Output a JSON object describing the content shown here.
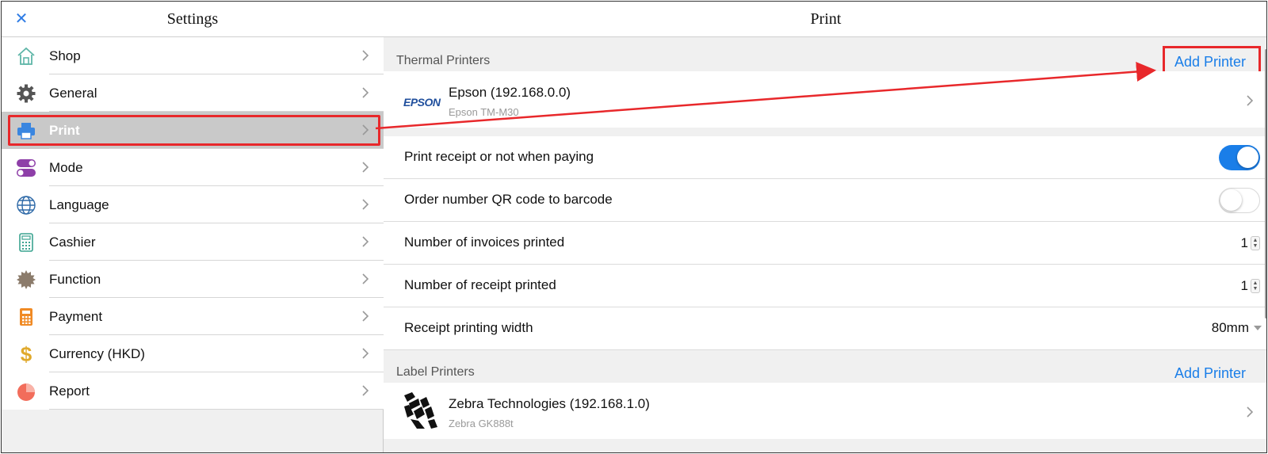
{
  "left": {
    "title": "Settings",
    "menu": [
      {
        "label": "Shop",
        "icon": "shop-icon"
      },
      {
        "label": "General",
        "icon": "gear-icon"
      },
      {
        "label": "Print",
        "icon": "printer-icon",
        "active": true
      },
      {
        "label": "Mode",
        "icon": "mode-toggle-icon"
      },
      {
        "label": "Language",
        "icon": "globe-icon"
      },
      {
        "label": "Cashier",
        "icon": "cashier-icon"
      },
      {
        "label": "Function",
        "icon": "function-icon"
      },
      {
        "label": "Payment",
        "icon": "calculator-icon"
      },
      {
        "label": "Currency (HKD)",
        "icon": "dollar-icon"
      },
      {
        "label": "Report",
        "icon": "pie-chart-icon"
      }
    ]
  },
  "right": {
    "title": "Print",
    "thermal": {
      "section_title": "Thermal Printers",
      "add_label": "Add Printer",
      "printer": {
        "name": "Epson (192.168.0.0)",
        "model": "Epson TM-M30",
        "logo_text": "EPSON"
      }
    },
    "settings": [
      {
        "label": "Print receipt or not when paying",
        "type": "toggle",
        "on": true
      },
      {
        "label": "Order number QR code to barcode",
        "type": "toggle",
        "on": false
      },
      {
        "label": "Number of invoices printed",
        "type": "stepper",
        "value": "1"
      },
      {
        "label": "Number of receipt printed",
        "type": "stepper",
        "value": "1"
      },
      {
        "label": "Receipt printing width",
        "type": "select",
        "value": "80mm"
      }
    ],
    "label": {
      "section_title": "Label Printers",
      "add_label": "Add Printer",
      "printer": {
        "name": "Zebra Technologies (192.168.1.0)",
        "model": "Zebra GK888t"
      }
    }
  },
  "colors": {
    "accent": "#1a7ee8",
    "highlight": "#e8282b"
  }
}
